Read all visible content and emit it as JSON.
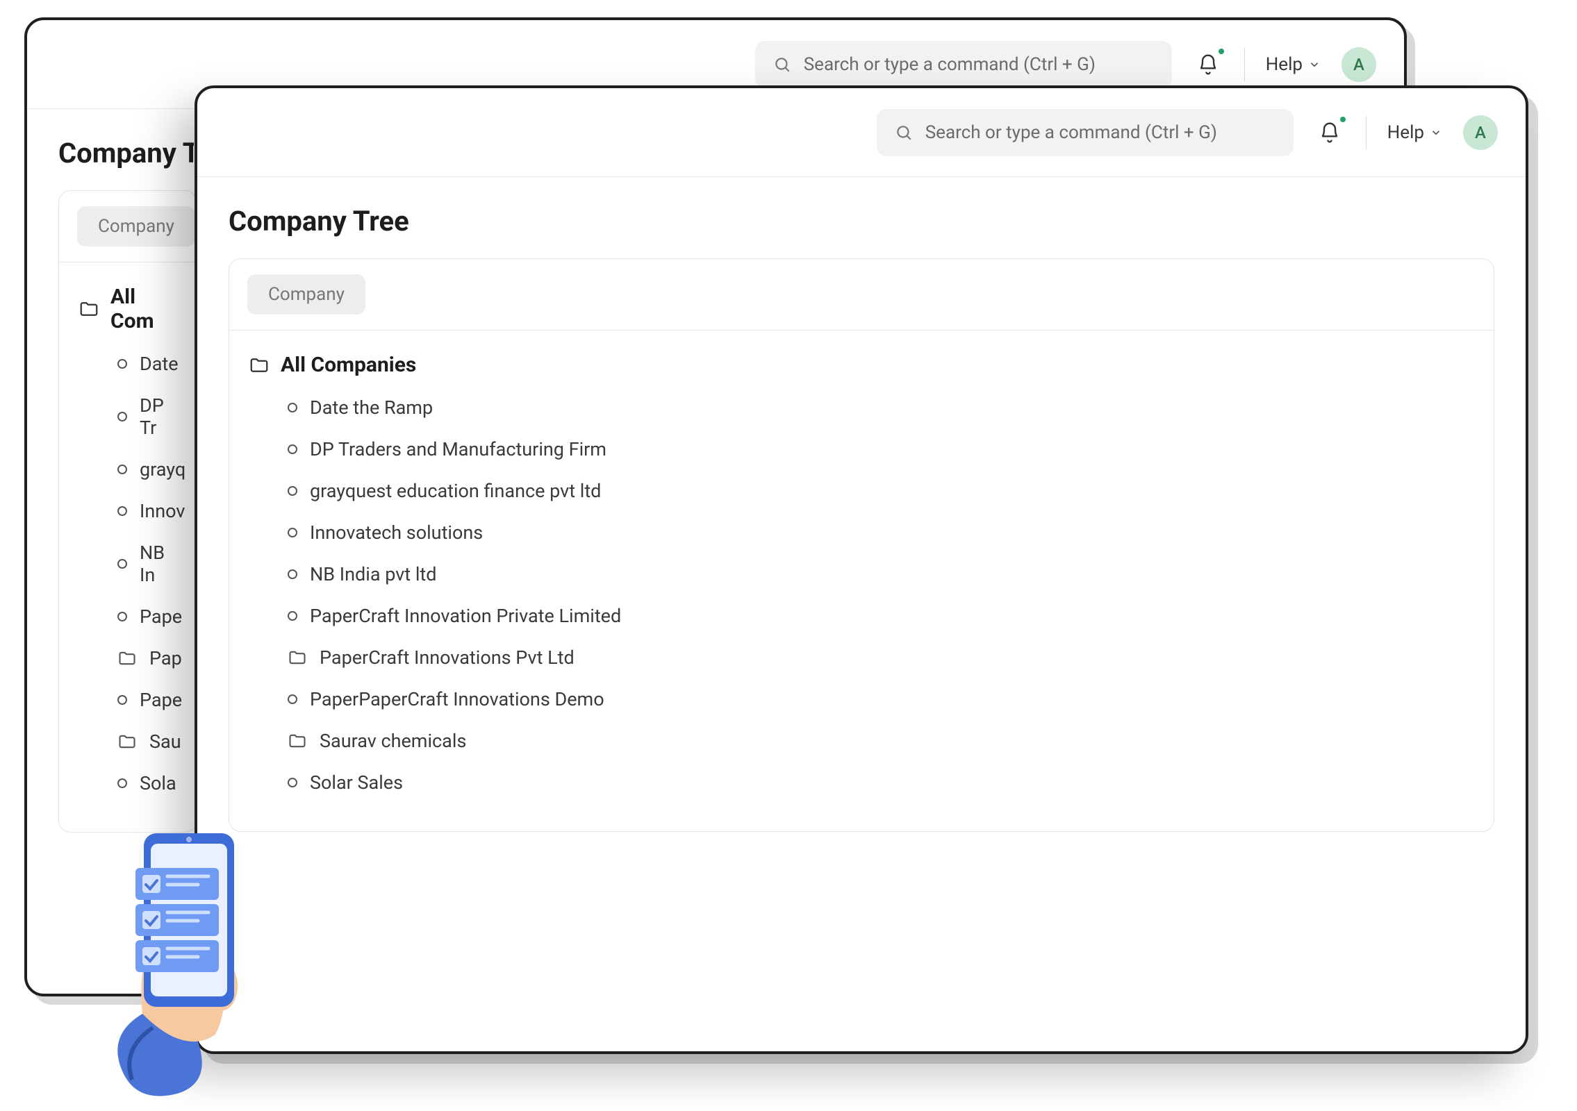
{
  "search": {
    "placeholder": "Search or type a command (Ctrl + G)"
  },
  "help": {
    "label": "Help"
  },
  "avatar": {
    "initial": "A"
  },
  "page": {
    "title": "Company Tree"
  },
  "filter": {
    "label": "Company"
  },
  "tree": {
    "root": "All Companies",
    "items": [
      {
        "type": "leaf",
        "label": "Date the Ramp"
      },
      {
        "type": "leaf",
        "label": "DP Traders and Manufacturing Firm"
      },
      {
        "type": "leaf",
        "label": "grayquest education finance pvt ltd"
      },
      {
        "type": "leaf",
        "label": "Innovatech solutions"
      },
      {
        "type": "leaf",
        "label": "NB India pvt ltd"
      },
      {
        "type": "leaf",
        "label": "PaperCraft Innovation Private Limited"
      },
      {
        "type": "folder",
        "label": "PaperCraft Innovations Pvt Ltd"
      },
      {
        "type": "leaf",
        "label": "PaperPaperCraft Innovations Demo"
      },
      {
        "type": "folder",
        "label": "Saurav chemicals"
      },
      {
        "type": "leaf",
        "label": "Solar Sales"
      }
    ]
  },
  "back_tree": {
    "root": "All Com",
    "items": [
      {
        "type": "leaf",
        "label": "Date"
      },
      {
        "type": "leaf",
        "label": "DP Tr"
      },
      {
        "type": "leaf",
        "label": "grayq"
      },
      {
        "type": "leaf",
        "label": "Innov"
      },
      {
        "type": "leaf",
        "label": "NB In"
      },
      {
        "type": "leaf",
        "label": "Pape"
      },
      {
        "type": "folder",
        "label": "Pap"
      },
      {
        "type": "leaf",
        "label": "Pape"
      },
      {
        "type": "folder",
        "label": "Sau"
      },
      {
        "type": "leaf",
        "label": "Sola"
      }
    ]
  }
}
